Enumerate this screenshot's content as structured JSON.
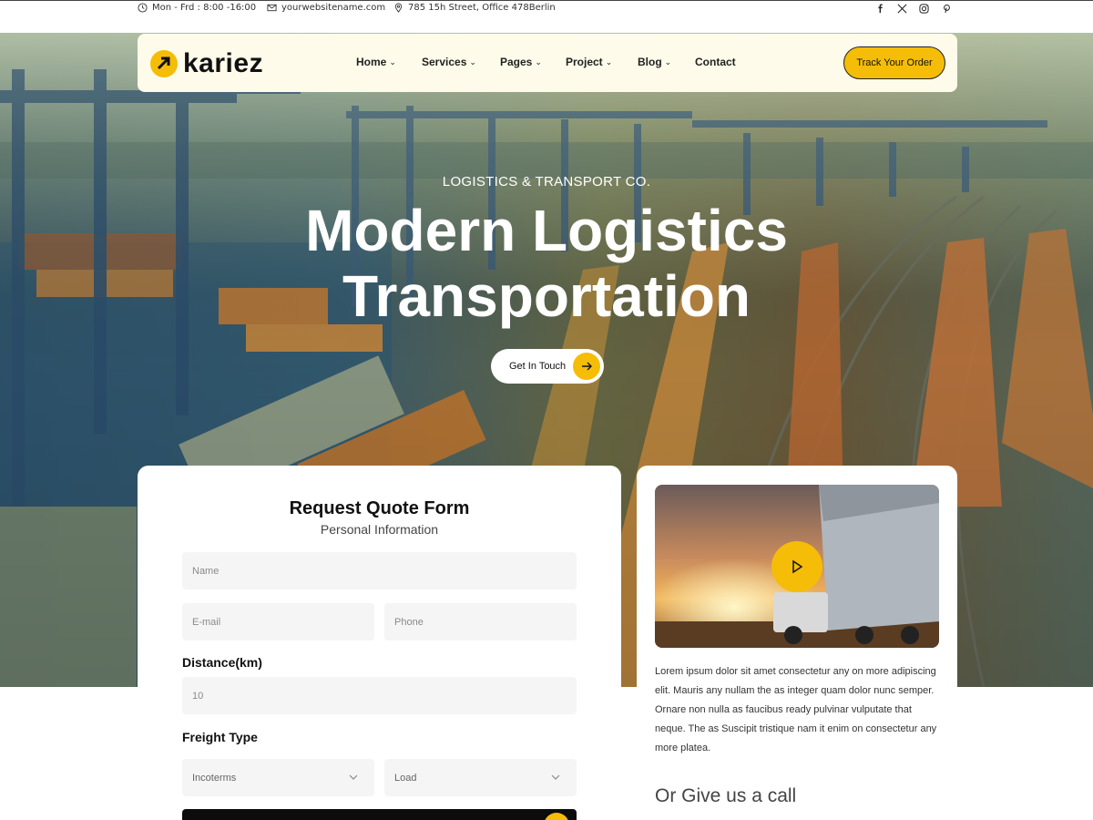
{
  "topbar": {
    "hours": "Mon - Frd : 8:00 -16:00",
    "email": "yourwebsitename.com",
    "address": "785 15h Street, Office 478Berlin",
    "social": [
      "facebook-icon",
      "x-icon",
      "instagram-icon",
      "pinterest-icon"
    ]
  },
  "nav": {
    "logo": "kariez",
    "menu": [
      {
        "label": "Home",
        "dropdown": true
      },
      {
        "label": "Services",
        "dropdown": true
      },
      {
        "label": "Pages",
        "dropdown": true
      },
      {
        "label": "Project",
        "dropdown": true
      },
      {
        "label": "Blog",
        "dropdown": true
      },
      {
        "label": "Contact",
        "dropdown": false
      }
    ],
    "cta": "Track Your Order"
  },
  "hero": {
    "subtitle": "LOGISTICS & TRANSPORT CO.",
    "title_line1": "Modern Logistics",
    "title_line2": "Transportation",
    "button": "Get In Touch"
  },
  "form": {
    "title": "Request Quote Form",
    "subtitle": "Personal Information",
    "name_placeholder": "Name",
    "email_placeholder": "E-mail",
    "phone_placeholder": "Phone",
    "distance_label": "Distance(km)",
    "distance_value": "10",
    "freight_label": "Freight Type",
    "incoterms": "Incoterms",
    "load": "Load"
  },
  "side": {
    "paragraph": "Lorem ipsum dolor sit amet consectetur any on more adipiscing elit. Mauris any nullam the as integer quam dolor nunc semper. Ornare non nulla as faucibus ready pulvinar vulputate that neque. The as Suscipit tristique nam it enim on consectetur any more platea.",
    "call_heading": "Or Give us a call"
  },
  "colors": {
    "accent": "#f5bd07",
    "nav_bg": "#fffbea",
    "dark": "#0c0c0c"
  }
}
